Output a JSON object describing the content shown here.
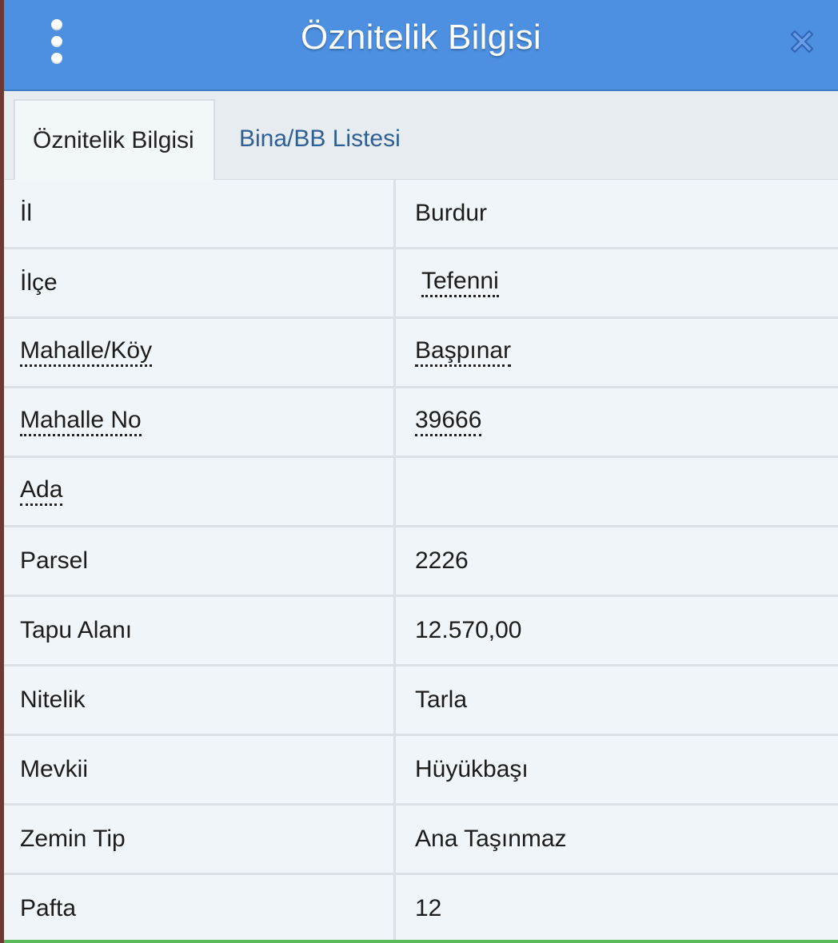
{
  "header": {
    "title": "Öznitelik Bilgisi",
    "menu_icon": "more-vertical-icon",
    "close_icon": "close-icon",
    "background_color": "#4d8fe0"
  },
  "tabs": [
    {
      "label": "Öznitelik Bilgisi",
      "active": true
    },
    {
      "label": "Bina/BB Listesi",
      "active": false
    }
  ],
  "rows": [
    {
      "label": "İl",
      "value": "Burdur"
    },
    {
      "label": "İlçe",
      "value": "Tefenni"
    },
    {
      "label": "Mahalle/Köy",
      "value": "Başpınar"
    },
    {
      "label": "Mahalle No",
      "value": "39666"
    },
    {
      "label": "Ada",
      "value": ""
    },
    {
      "label": "Parsel",
      "value": "2226"
    },
    {
      "label": "Tapu Alanı",
      "value": "12.570,00"
    },
    {
      "label": "Nitelik",
      "value": "Tarla"
    },
    {
      "label": "Mevkii",
      "value": "Hüyükbaşı"
    },
    {
      "label": "Zemin Tip",
      "value": "Ana Taşınmaz"
    },
    {
      "label": "Pafta",
      "value": "12"
    }
  ]
}
